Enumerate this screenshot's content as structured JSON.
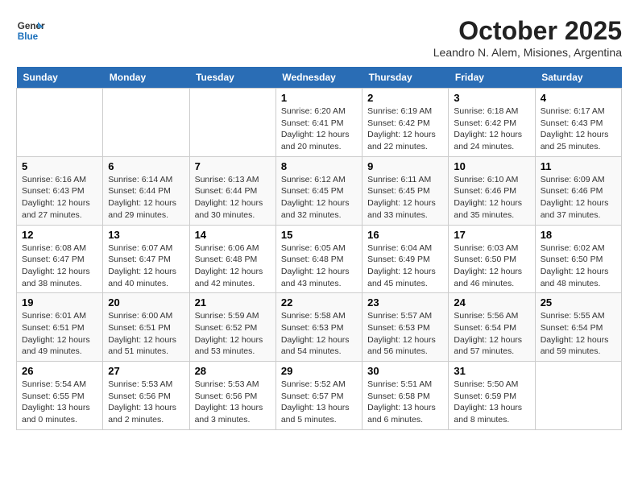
{
  "header": {
    "logo_line1": "General",
    "logo_line2": "Blue",
    "month_title": "October 2025",
    "location": "Leandro N. Alem, Misiones, Argentina"
  },
  "days_of_week": [
    "Sunday",
    "Monday",
    "Tuesday",
    "Wednesday",
    "Thursday",
    "Friday",
    "Saturday"
  ],
  "weeks": [
    [
      {
        "day": "",
        "info": ""
      },
      {
        "day": "",
        "info": ""
      },
      {
        "day": "",
        "info": ""
      },
      {
        "day": "1",
        "info": "Sunrise: 6:20 AM\nSunset: 6:41 PM\nDaylight: 12 hours\nand 20 minutes."
      },
      {
        "day": "2",
        "info": "Sunrise: 6:19 AM\nSunset: 6:42 PM\nDaylight: 12 hours\nand 22 minutes."
      },
      {
        "day": "3",
        "info": "Sunrise: 6:18 AM\nSunset: 6:42 PM\nDaylight: 12 hours\nand 24 minutes."
      },
      {
        "day": "4",
        "info": "Sunrise: 6:17 AM\nSunset: 6:43 PM\nDaylight: 12 hours\nand 25 minutes."
      }
    ],
    [
      {
        "day": "5",
        "info": "Sunrise: 6:16 AM\nSunset: 6:43 PM\nDaylight: 12 hours\nand 27 minutes."
      },
      {
        "day": "6",
        "info": "Sunrise: 6:14 AM\nSunset: 6:44 PM\nDaylight: 12 hours\nand 29 minutes."
      },
      {
        "day": "7",
        "info": "Sunrise: 6:13 AM\nSunset: 6:44 PM\nDaylight: 12 hours\nand 30 minutes."
      },
      {
        "day": "8",
        "info": "Sunrise: 6:12 AM\nSunset: 6:45 PM\nDaylight: 12 hours\nand 32 minutes."
      },
      {
        "day": "9",
        "info": "Sunrise: 6:11 AM\nSunset: 6:45 PM\nDaylight: 12 hours\nand 33 minutes."
      },
      {
        "day": "10",
        "info": "Sunrise: 6:10 AM\nSunset: 6:46 PM\nDaylight: 12 hours\nand 35 minutes."
      },
      {
        "day": "11",
        "info": "Sunrise: 6:09 AM\nSunset: 6:46 PM\nDaylight: 12 hours\nand 37 minutes."
      }
    ],
    [
      {
        "day": "12",
        "info": "Sunrise: 6:08 AM\nSunset: 6:47 PM\nDaylight: 12 hours\nand 38 minutes."
      },
      {
        "day": "13",
        "info": "Sunrise: 6:07 AM\nSunset: 6:47 PM\nDaylight: 12 hours\nand 40 minutes."
      },
      {
        "day": "14",
        "info": "Sunrise: 6:06 AM\nSunset: 6:48 PM\nDaylight: 12 hours\nand 42 minutes."
      },
      {
        "day": "15",
        "info": "Sunrise: 6:05 AM\nSunset: 6:48 PM\nDaylight: 12 hours\nand 43 minutes."
      },
      {
        "day": "16",
        "info": "Sunrise: 6:04 AM\nSunset: 6:49 PM\nDaylight: 12 hours\nand 45 minutes."
      },
      {
        "day": "17",
        "info": "Sunrise: 6:03 AM\nSunset: 6:50 PM\nDaylight: 12 hours\nand 46 minutes."
      },
      {
        "day": "18",
        "info": "Sunrise: 6:02 AM\nSunset: 6:50 PM\nDaylight: 12 hours\nand 48 minutes."
      }
    ],
    [
      {
        "day": "19",
        "info": "Sunrise: 6:01 AM\nSunset: 6:51 PM\nDaylight: 12 hours\nand 49 minutes."
      },
      {
        "day": "20",
        "info": "Sunrise: 6:00 AM\nSunset: 6:51 PM\nDaylight: 12 hours\nand 51 minutes."
      },
      {
        "day": "21",
        "info": "Sunrise: 5:59 AM\nSunset: 6:52 PM\nDaylight: 12 hours\nand 53 minutes."
      },
      {
        "day": "22",
        "info": "Sunrise: 5:58 AM\nSunset: 6:53 PM\nDaylight: 12 hours\nand 54 minutes."
      },
      {
        "day": "23",
        "info": "Sunrise: 5:57 AM\nSunset: 6:53 PM\nDaylight: 12 hours\nand 56 minutes."
      },
      {
        "day": "24",
        "info": "Sunrise: 5:56 AM\nSunset: 6:54 PM\nDaylight: 12 hours\nand 57 minutes."
      },
      {
        "day": "25",
        "info": "Sunrise: 5:55 AM\nSunset: 6:54 PM\nDaylight: 12 hours\nand 59 minutes."
      }
    ],
    [
      {
        "day": "26",
        "info": "Sunrise: 5:54 AM\nSunset: 6:55 PM\nDaylight: 13 hours\nand 0 minutes."
      },
      {
        "day": "27",
        "info": "Sunrise: 5:53 AM\nSunset: 6:56 PM\nDaylight: 13 hours\nand 2 minutes."
      },
      {
        "day": "28",
        "info": "Sunrise: 5:53 AM\nSunset: 6:56 PM\nDaylight: 13 hours\nand 3 minutes."
      },
      {
        "day": "29",
        "info": "Sunrise: 5:52 AM\nSunset: 6:57 PM\nDaylight: 13 hours\nand 5 minutes."
      },
      {
        "day": "30",
        "info": "Sunrise: 5:51 AM\nSunset: 6:58 PM\nDaylight: 13 hours\nand 6 minutes."
      },
      {
        "day": "31",
        "info": "Sunrise: 5:50 AM\nSunset: 6:59 PM\nDaylight: 13 hours\nand 8 minutes."
      },
      {
        "day": "",
        "info": ""
      }
    ]
  ]
}
